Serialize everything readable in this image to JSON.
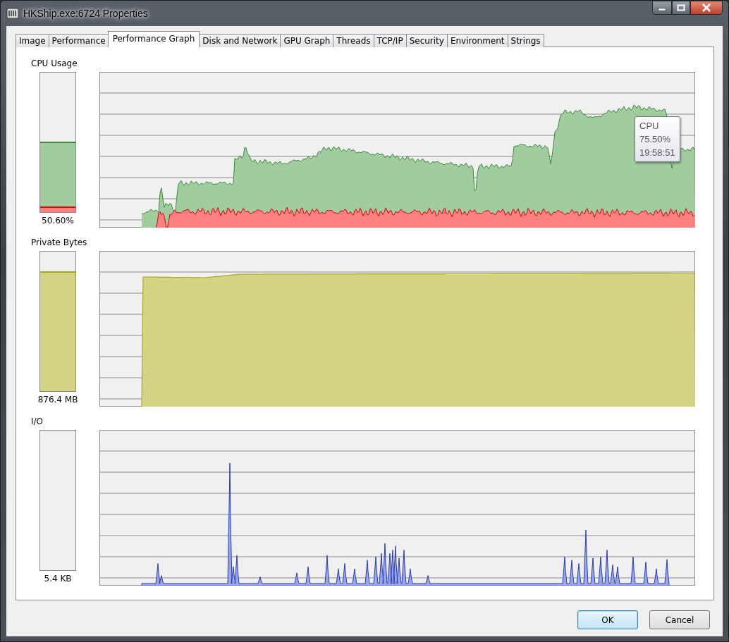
{
  "window": {
    "title": "HKShip.exe:6724 Properties"
  },
  "tabs": [
    {
      "label": "Image",
      "selected": false
    },
    {
      "label": "Performance",
      "selected": false
    },
    {
      "label": "Performance Graph",
      "selected": true
    },
    {
      "label": "Disk and Network",
      "selected": false
    },
    {
      "label": "GPU Graph",
      "selected": false
    },
    {
      "label": "Threads",
      "selected": false
    },
    {
      "label": "TCP/IP",
      "selected": false
    },
    {
      "label": "Security",
      "selected": false
    },
    {
      "label": "Environment",
      "selected": false
    },
    {
      "label": "Strings",
      "selected": false
    }
  ],
  "graphs": [
    {
      "kind": "cpu",
      "label": "CPU Usage",
      "reading": "50.60%",
      "meter": [
        {
          "level": 0.04,
          "color": "#ff8080"
        },
        {
          "level": 0.465,
          "color": "#a0cca0"
        }
      ],
      "tooltip": {
        "lines": [
          "CPU",
          "75.50%",
          "19:58:51"
        ]
      }
    },
    {
      "kind": "memory",
      "label": "Private Bytes",
      "reading": "876.4 MB",
      "meter": [
        {
          "level": 0.86,
          "color": "#d4d484"
        }
      ]
    },
    {
      "kind": "io",
      "label": "I/O",
      "reading": "5.4  KB",
      "meter": [
        {
          "level": 0
        }
      ]
    }
  ],
  "buttons": [
    {
      "label": "OK",
      "default": true
    },
    {
      "label": "Cancel",
      "default": false
    }
  ]
}
